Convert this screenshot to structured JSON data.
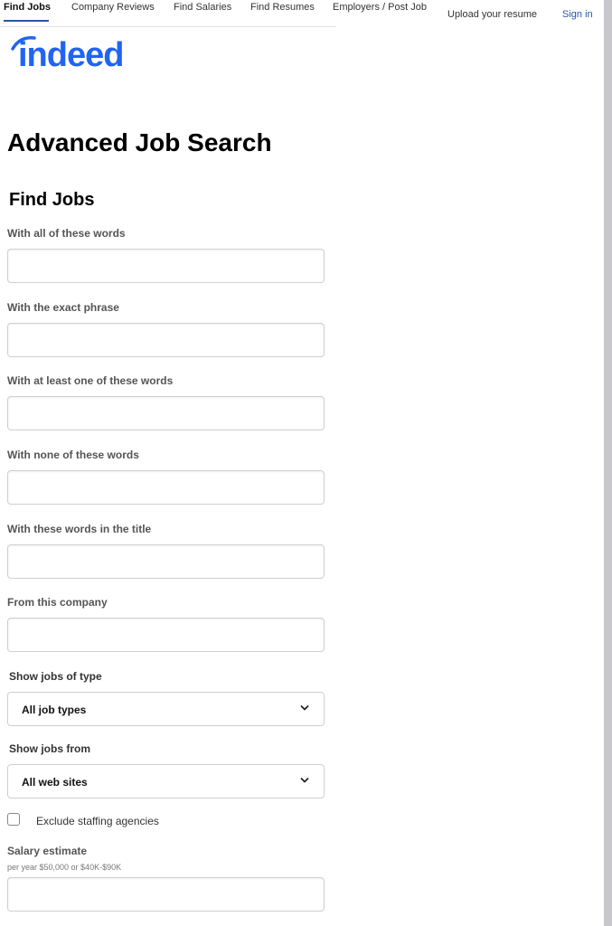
{
  "nav": {
    "items": [
      {
        "label": "Find Jobs",
        "active": true
      },
      {
        "label": "Company Reviews",
        "active": false
      },
      {
        "label": "Find Salaries",
        "active": false
      },
      {
        "label": "Find Resumes",
        "active": false
      },
      {
        "label": "Employers / Post Job",
        "active": false
      }
    ],
    "upload_resume": "Upload your resume",
    "sign_in": "Sign in"
  },
  "logo": {
    "text": "indeed",
    "color": "#2164f3"
  },
  "page_title": "Advanced Job Search",
  "section_title": "Find Jobs",
  "fields": {
    "all_words": {
      "label": "With all of these words",
      "value": ""
    },
    "exact_phrase": {
      "label": "With the exact phrase",
      "value": ""
    },
    "at_least_one": {
      "label": "With at least one of these words",
      "value": ""
    },
    "none_words": {
      "label": "With none of these words",
      "value": ""
    },
    "title_words": {
      "label": "With these words in the title",
      "value": ""
    },
    "company": {
      "label": "From this company",
      "value": ""
    }
  },
  "job_type": {
    "label": "Show jobs of type",
    "selected": "All job types"
  },
  "jobs_from": {
    "label": "Show jobs from",
    "selected": "All web sites"
  },
  "exclude_staffing": {
    "label": "Exclude staffing agencies",
    "checked": false
  },
  "salary": {
    "label": "Salary estimate",
    "hint": "per year $50,000 or $40K-$90K",
    "value": ""
  },
  "colors": {
    "link": "#2557a7",
    "logo": "#2164f3",
    "active_underline": "#2557a7"
  }
}
